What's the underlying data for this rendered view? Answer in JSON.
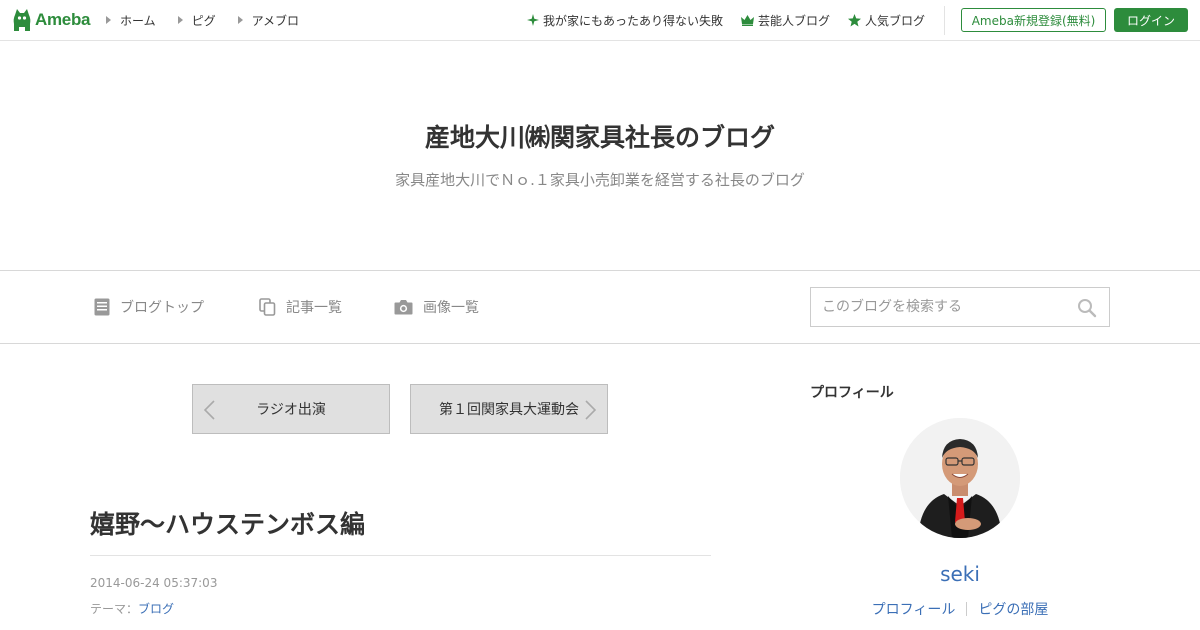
{
  "topbar": {
    "logo_text": "Ameba",
    "nav_left": [
      "ホーム",
      "ピグ",
      "アメブロ"
    ],
    "nav_right": [
      {
        "icon": "sparkle-icon",
        "label": "我が家にもあったあり得ない失敗"
      },
      {
        "icon": "crown-icon",
        "label": "芸能人ブログ"
      },
      {
        "icon": "star-icon",
        "label": "人気ブログ"
      }
    ],
    "register_label": "Ameba新規登録(無料)",
    "login_label": "ログイン"
  },
  "header": {
    "title": "産地大川㈱関家具社長のブログ",
    "subtitle": "家具産地大川でＮｏ.１家具小売卸業を経営する社長のブログ"
  },
  "blog_nav": {
    "items": [
      {
        "icon": "document-icon",
        "label": "ブログトップ"
      },
      {
        "icon": "copy-icon",
        "label": "記事一覧"
      },
      {
        "icon": "camera-icon",
        "label": "画像一覧"
      }
    ],
    "search_placeholder": "このブログを検索する"
  },
  "pager": {
    "prev_label": "ラジオ出演",
    "next_label": "第１回関家具大運動会"
  },
  "article": {
    "title": "嬉野～ハウステンボス編",
    "date": "2014-06-24 05:37:03",
    "theme_prefix": "テーマ：",
    "theme": "ブログ"
  },
  "sidebar": {
    "heading": "プロフィール",
    "name": "seki",
    "links": [
      "プロフィール",
      "ピグの部屋"
    ]
  },
  "colors": {
    "accent_green": "#2d8c3c",
    "link_blue": "#3b6fb6"
  }
}
